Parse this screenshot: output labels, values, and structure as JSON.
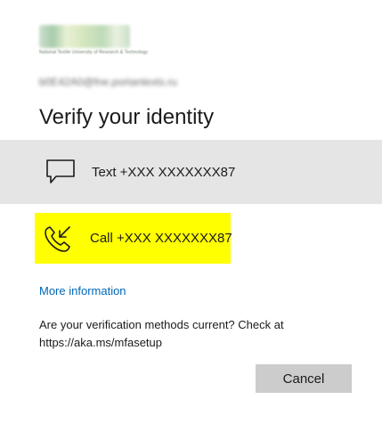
{
  "header": {
    "logo_subtitle": "National Textile University of Research & Technology",
    "account_email": "b0E42A0@fne.portantexts.ru"
  },
  "main": {
    "title": "Verify your identity",
    "options": [
      {
        "icon": "sms-icon",
        "label": "Text +XXX XXXXXXX87"
      },
      {
        "icon": "phone-call-icon",
        "label": "Call +XXX XXXXXXX87"
      }
    ],
    "more_info_link": "More information",
    "note_line1": "Are your verification methods current? Check at",
    "note_line2": "https://aka.ms/mfasetup"
  },
  "footer": {
    "cancel_label": "Cancel"
  },
  "colors": {
    "selected_background": "#e5e5e5",
    "highlight": "#ffff00",
    "link": "#0067b8",
    "button": "#cccccc"
  }
}
